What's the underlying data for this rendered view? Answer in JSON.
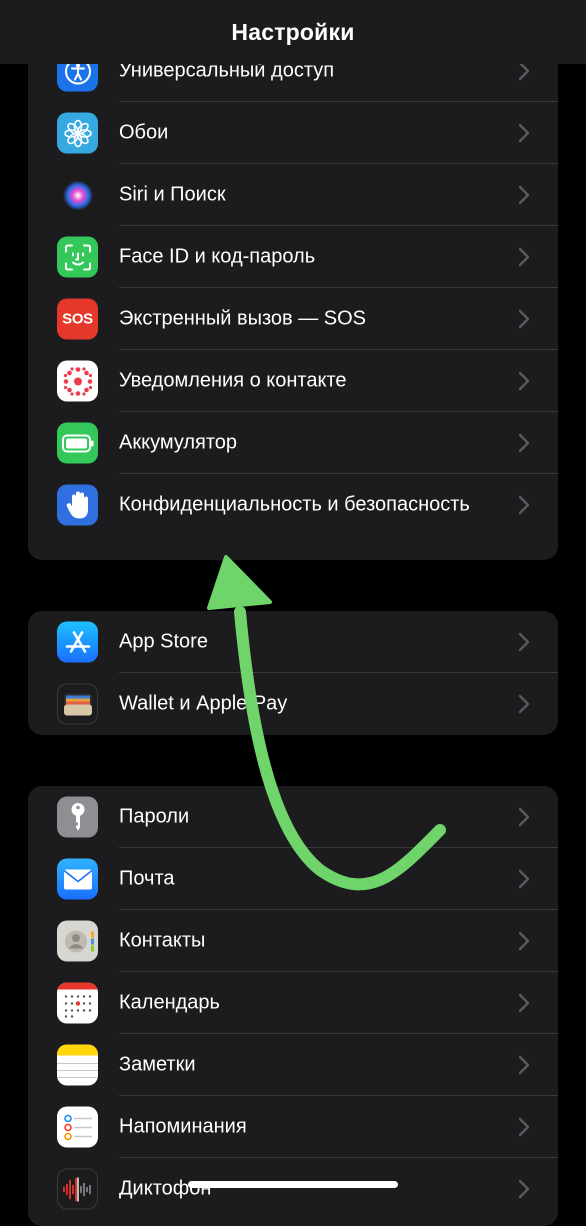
{
  "header": {
    "title": "Настройки"
  },
  "groups": [
    {
      "items": [
        {
          "label": "Универсальный доступ",
          "icon": "accessibility-icon",
          "color": "#1a73e8"
        },
        {
          "label": "Обои",
          "icon": "wallpaper-flower-icon",
          "color": "#36a9e1"
        },
        {
          "label": "Siri и Поиск",
          "icon": "siri-icon",
          "color": "#1b1b1b"
        },
        {
          "label": "Face ID и код-пароль",
          "icon": "face-id-icon",
          "color": "#34c759"
        },
        {
          "label": "Экстренный вызов — SOS",
          "icon": "sos-icon",
          "color": "#e5382b",
          "icon_text": "SOS"
        },
        {
          "label": "Уведомления о контакте",
          "icon": "exposure-notification-icon",
          "color": "#ffffff"
        },
        {
          "label": "Аккумулятор",
          "icon": "battery-icon",
          "color": "#34c759"
        },
        {
          "label": "Конфиденциальность и безопасность",
          "icon": "privacy-hand-icon",
          "color": "#2f6fe0"
        }
      ]
    },
    {
      "items": [
        {
          "label": "App Store",
          "icon": "app-store-icon",
          "color": "#1a8cff"
        },
        {
          "label": "Wallet и Apple Pay",
          "icon": "wallet-icon",
          "color": "#1c1c1e"
        }
      ]
    },
    {
      "items": [
        {
          "label": "Пароли",
          "icon": "key-icon",
          "color": "#8e8e93"
        },
        {
          "label": "Почта",
          "icon": "mail-icon",
          "color": "#1a8cff"
        },
        {
          "label": "Контакты",
          "icon": "contacts-icon",
          "color": "#d8d6d0"
        },
        {
          "label": "Календарь",
          "icon": "calendar-icon",
          "color": "#ffffff"
        },
        {
          "label": "Заметки",
          "icon": "notes-icon",
          "color": "#ffffff"
        },
        {
          "label": "Напоминания",
          "icon": "reminders-icon",
          "color": "#ffffff"
        },
        {
          "label": "Диктофон",
          "icon": "voice-memos-icon",
          "color": "#1c1c1e"
        }
      ]
    }
  ],
  "annotation": {
    "icon": "green-curved-arrow-icon",
    "color": "#6fd46a"
  }
}
